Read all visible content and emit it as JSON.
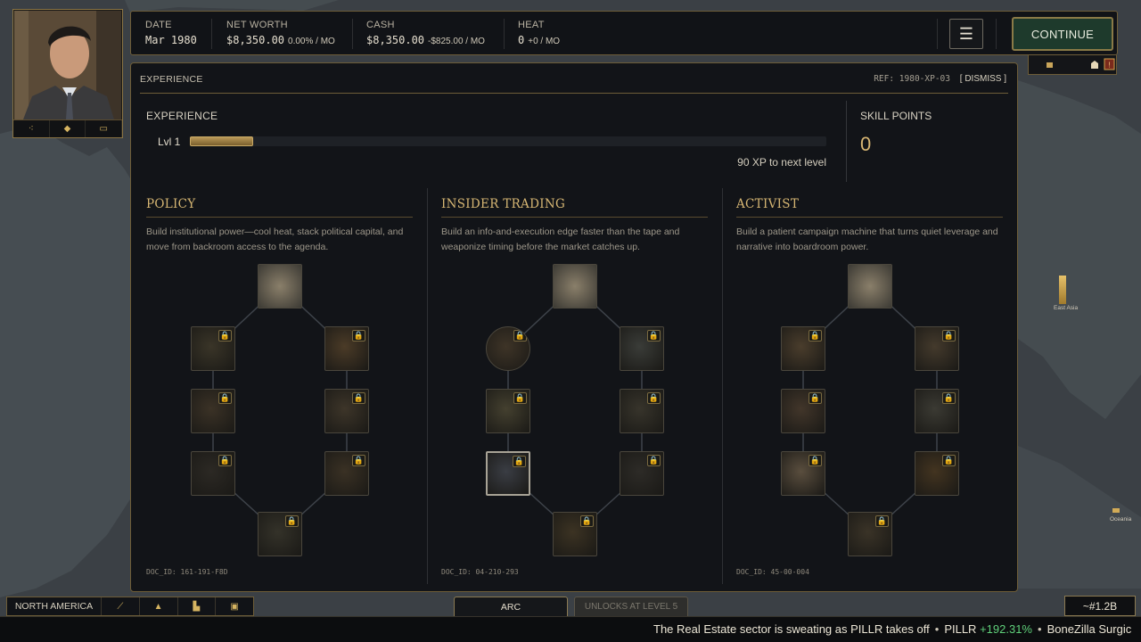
{
  "topbar": {
    "date": {
      "label": "DATE",
      "value": "Mar 1980"
    },
    "net_worth": {
      "label": "NET WORTH",
      "value": "$8,350.00",
      "delta": "0.00% / MO"
    },
    "cash": {
      "label": "CASH",
      "value": "$8,350.00",
      "delta": "-$825.00 / MO"
    },
    "heat": {
      "label": "HEAT",
      "value": "0",
      "delta": "+0 / MO"
    },
    "menu_icon": "hamburger-icon",
    "continue_label": "CONTINUE"
  },
  "panel": {
    "header": "EXPERIENCE",
    "ref": "REF: 1980-XP-03",
    "dismiss": "[ DISMISS ]",
    "experience_title": "EXPERIENCE",
    "level": "Lvl 1",
    "progress": 0.1,
    "xp_next": "90 XP to next level",
    "skill_points_label": "SKILL POINTS",
    "skill_points": "0"
  },
  "trees": [
    {
      "title": "POLICY",
      "desc": "Build institutional power—cool heat, stack political capital, and move from backroom access to the agenda.",
      "doc_id": "DOC_ID: 161-191-F8D"
    },
    {
      "title": "INSIDER TRADING",
      "desc": "Build an info-and-execution edge faster than the tape and weaponize timing before the market catches up.",
      "doc_id": "DOC_ID: 04-210-293"
    },
    {
      "title": "ACTIVIST",
      "desc": "Build a patient campaign machine that turns quiet leverage and narrative into boardroom power.",
      "doc_id": "DOC_ID: 45-00-004"
    }
  ],
  "bottom": {
    "region": "NORTH AMERICA",
    "tab_arc": "ARC",
    "tab_unlocks": "UNLOCKS AT LEVEL 5",
    "market_cap": "~#1.2B"
  },
  "ticker": {
    "item1": "The Real Estate sector is sweating as PILLR takes off",
    "sep1": "•",
    "item2_symbol": "PILLR",
    "item2_change": "+192.31%",
    "sep2": "•",
    "item3": "BoneZilla Surgic"
  },
  "map_labels": {
    "east_asia": "East Asia",
    "oceania": "Oceania"
  },
  "colors": {
    "accent_gold": "#d6b673",
    "continue_green": "#1e3a2c",
    "positive": "#5fd07a"
  }
}
